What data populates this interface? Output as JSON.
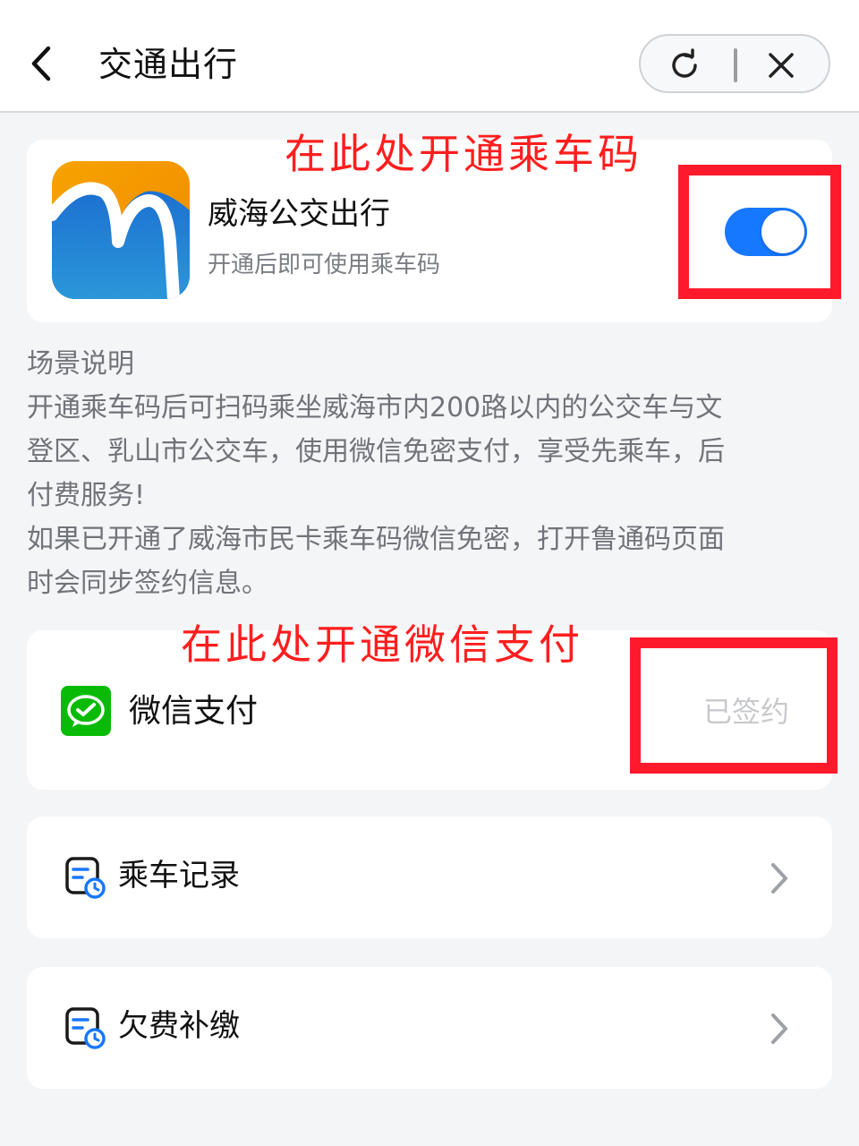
{
  "header": {
    "title": "交通出行",
    "back_icon": "chevron-left-icon",
    "refresh_icon": "refresh-icon",
    "close_icon": "close-icon"
  },
  "app_card": {
    "name": "威海公交出行",
    "subtitle": "开通后即可使用乘车码",
    "toggle_on": true,
    "accent_color": "#1677ff"
  },
  "description": {
    "lines": [
      "场景说明",
      "开通乘车码后可扫码乘坐威海市内200路以内的公交车与文",
      "登区、乳山市公交车，使用微信免密支付，享受先乘车，后",
      "付费服务!",
      "如果已开通了威海市民卡乘车码微信免密，打开鲁通码页面",
      "时会同步签约信息。"
    ]
  },
  "payment_card": {
    "label": "微信支付",
    "status": "已签约",
    "icon": "wechat-pay-icon",
    "icon_color": "#09bb07"
  },
  "menu": {
    "items": [
      {
        "label": "乘车记录",
        "icon": "record-clock-icon"
      },
      {
        "label": "欠费补缴",
        "icon": "record-clock-icon"
      }
    ]
  },
  "annotations": {
    "open_code": "在此处开通乘车码",
    "open_wechat": "在此处开通微信支付",
    "color": "#ff1e1e"
  }
}
